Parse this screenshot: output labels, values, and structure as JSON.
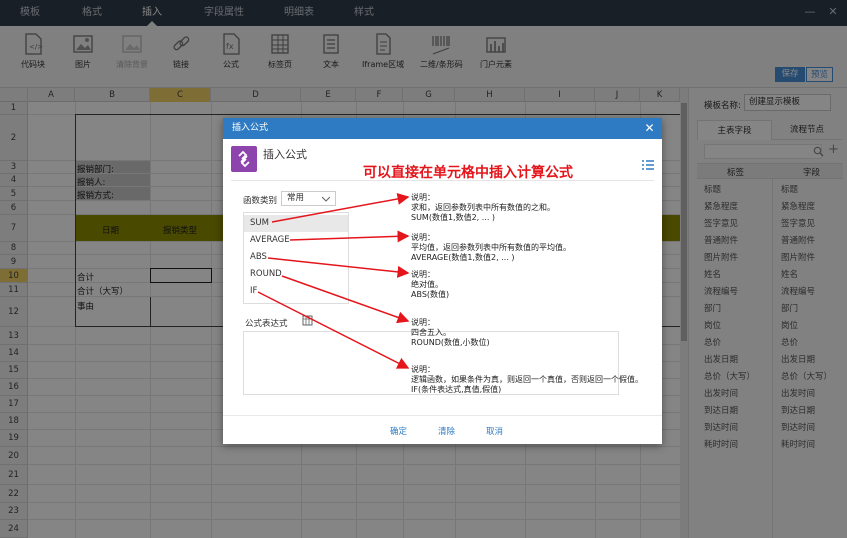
{
  "topnav": {
    "tabs": [
      "模板",
      "格式",
      "插入",
      "字段属性",
      "明细表",
      "样式"
    ],
    "active_tab": "插入"
  },
  "ribbon": {
    "items": [
      {
        "label": "代码块",
        "icon": "code-block-icon",
        "disabled": false
      },
      {
        "label": "图片",
        "icon": "image-icon",
        "disabled": false
      },
      {
        "label": "清除背景",
        "icon": "clear-background-icon",
        "disabled": true
      },
      {
        "label": "链接",
        "icon": "link-icon",
        "disabled": false
      },
      {
        "label": "公式",
        "icon": "formula-icon",
        "disabled": false
      },
      {
        "label": "标签页",
        "icon": "tab-page-icon",
        "disabled": false
      },
      {
        "label": "文本",
        "icon": "text-icon",
        "disabled": false
      },
      {
        "label": "Iframe区域",
        "icon": "iframe-icon",
        "disabled": false
      },
      {
        "label": "二维/条形码",
        "icon": "barcode-icon",
        "disabled": false
      },
      {
        "label": "门户元素",
        "icon": "portal-element-icon",
        "disabled": false
      }
    ],
    "save_label": "保存",
    "preview_label": "预览"
  },
  "sheet": {
    "columns": [
      "A",
      "B",
      "C",
      "D",
      "E",
      "F",
      "G",
      "H",
      "I",
      "J",
      "K"
    ],
    "selected_column": "C",
    "rows": [
      "1",
      "2",
      "3",
      "4",
      "5",
      "6",
      "7",
      "8",
      "9",
      "10",
      "11",
      "12",
      "13",
      "14",
      "15",
      "16",
      "17",
      "18",
      "19",
      "20",
      "21",
      "22",
      "23",
      "24",
      "25"
    ],
    "selected_row": "10",
    "cells": {
      "b3": "报销部门:",
      "b4": "报销人:",
      "b5": "报销方式:",
      "b7": "日期",
      "c7": "报销类型",
      "b10": "合计",
      "b11": "合计（大写）",
      "b12": "事由"
    }
  },
  "right_panel": {
    "template_name_label": "模板名称:",
    "template_name_value": "创建显示模板",
    "tabs": [
      "主表字段",
      "流程节点"
    ],
    "active_tab": "主表字段",
    "col_tag": "标签",
    "col_field": "字段",
    "fields": [
      {
        "tag": "标题",
        "field": "标题"
      },
      {
        "tag": "紧急程度",
        "field": "紧急程度"
      },
      {
        "tag": "签字意见",
        "field": "签字意见"
      },
      {
        "tag": "普通附件",
        "field": "普通附件"
      },
      {
        "tag": "图片附件",
        "field": "图片附件"
      },
      {
        "tag": "姓名",
        "field": "姓名"
      },
      {
        "tag": "流程编号",
        "field": "流程编号"
      },
      {
        "tag": "部门",
        "field": "部门"
      },
      {
        "tag": "岗位",
        "field": "岗位"
      },
      {
        "tag": "总价",
        "field": "总价"
      },
      {
        "tag": "出发日期",
        "field": "出发日期"
      },
      {
        "tag": "总价（大写）",
        "field": "总价（大写）"
      },
      {
        "tag": "出发时间",
        "field": "出发时间"
      },
      {
        "tag": "到达日期",
        "field": "到达日期"
      },
      {
        "tag": "到达时间",
        "field": "到达时间"
      },
      {
        "tag": "耗时时间",
        "field": "耗时时间"
      }
    ]
  },
  "dialog": {
    "title": "插入公式",
    "subtitle": "插入公式",
    "category_label": "函数类别",
    "category_value": "常用",
    "functions": [
      "SUM",
      "AVERAGE",
      "ABS",
      "ROUND",
      "IF"
    ],
    "selected_function": "SUM",
    "expression_label": "公式表达式",
    "confirm_label": "确定",
    "clear_label": "清除",
    "cancel_label": "取消"
  },
  "annotation": {
    "caption": "可以直接在单元格中插入计算公式",
    "arrow_color": "#e4151b",
    "descriptions": [
      {
        "title": "说明：",
        "body": "求和，返回参数列表中所有数值的之和。",
        "syntax": "SUM(数值1,数值2, ... )"
      },
      {
        "title": "说明：",
        "body": "平均值，返回参数列表中所有数值的平均值。",
        "syntax": "AVERAGE(数值1,数值2, ... )"
      },
      {
        "title": "说明：",
        "body": "绝对值。",
        "syntax": "ABS(数值)"
      },
      {
        "title": "说明：",
        "body": "四舍五入。",
        "syntax": "ROUND(数值,小数位)"
      },
      {
        "title": "说明：",
        "body": "逻辑函数，如果条件为真，则返回一个真值，否则返回一个假值。",
        "syntax": "IF(条件表达式,真值,假值)"
      }
    ]
  }
}
